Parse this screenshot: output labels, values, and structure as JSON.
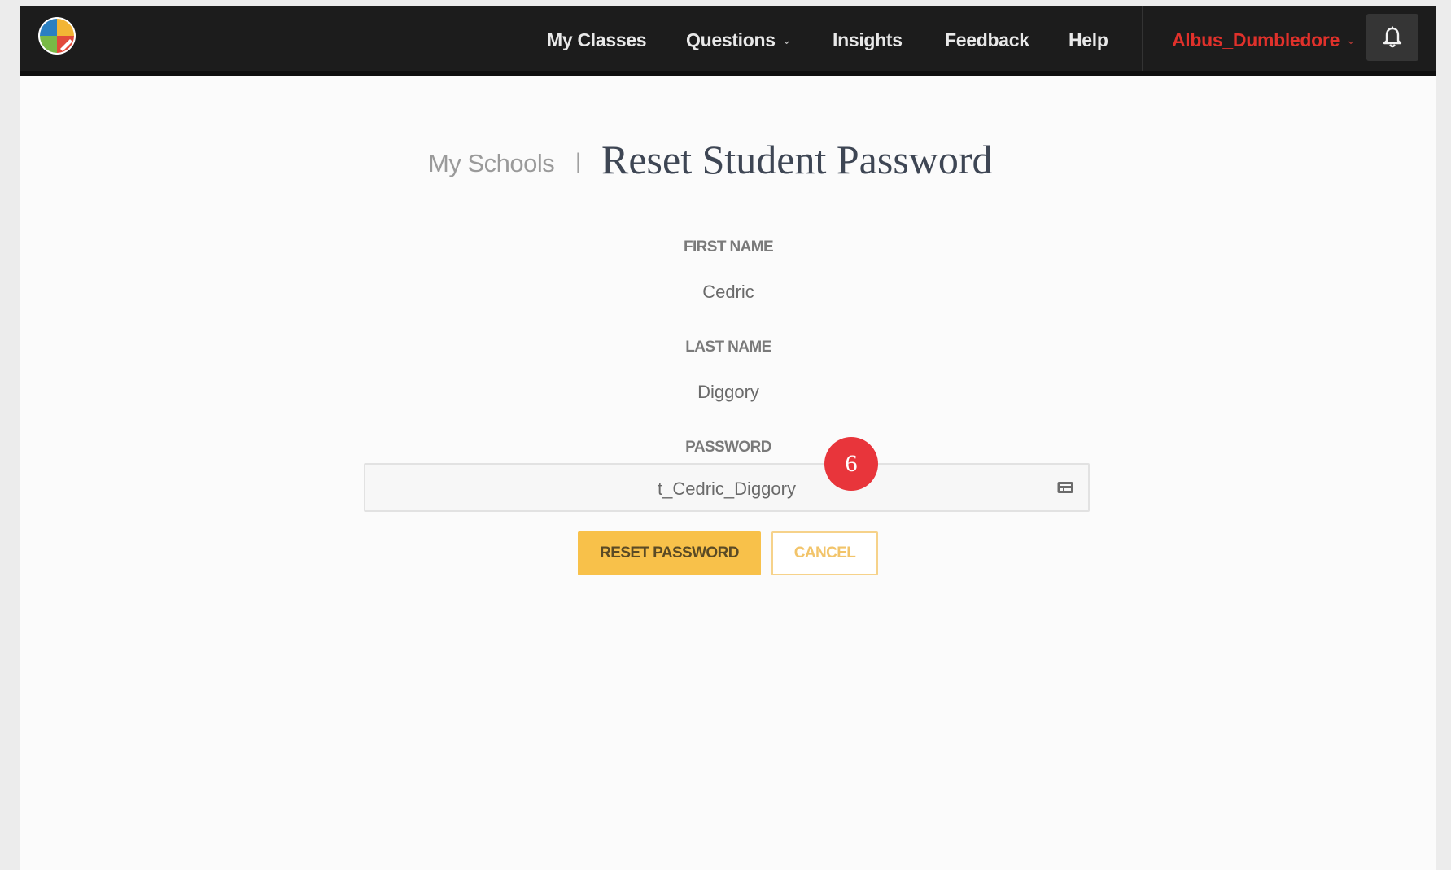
{
  "nav": {
    "items": [
      {
        "label": "My Classes"
      },
      {
        "label": "Questions",
        "has_dropdown": true
      },
      {
        "label": "Insights"
      },
      {
        "label": "Feedback"
      },
      {
        "label": "Help"
      }
    ],
    "user": {
      "name": "Albus_Dumbledore",
      "color": "#e0312b"
    },
    "notifications_icon": "bell-icon",
    "logo_icon": "quadrant-logo-icon"
  },
  "header": {
    "breadcrumb": "My Schools",
    "separator": "|",
    "title": "Reset Student Password"
  },
  "form": {
    "first_name": {
      "label": "FIRST NAME",
      "value": "Cedric"
    },
    "last_name": {
      "label": "LAST NAME",
      "value": "Diggory"
    },
    "password": {
      "label": "PASSWORD",
      "value": "t_Cedric_Diggory",
      "icon": "key-card-icon"
    }
  },
  "annotation": {
    "step": "6",
    "color": "#e8353b"
  },
  "actions": {
    "reset_label": "RESET PASSWORD",
    "cancel_label": "CANCEL",
    "accent_color": "#f8c14a"
  }
}
